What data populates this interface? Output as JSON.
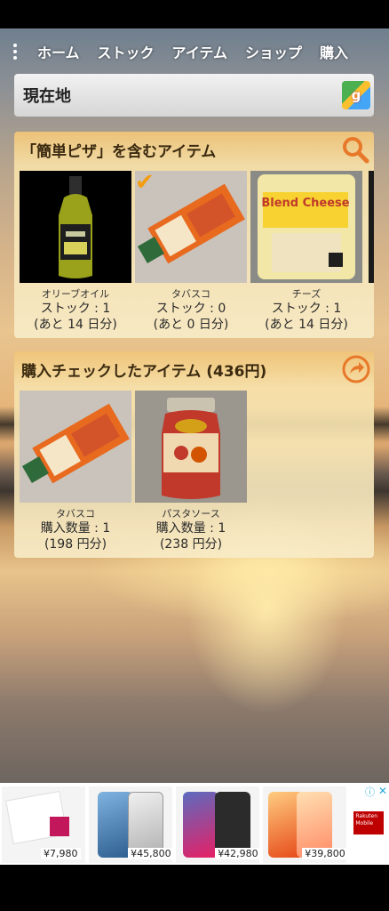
{
  "nav": {
    "tabs": [
      "ホーム",
      "ストック",
      "アイテム",
      "ショップ",
      "購入"
    ]
  },
  "location": {
    "label": "現在地"
  },
  "search_card": {
    "title": "「簡単ピザ」を含むアイテム",
    "items": [
      {
        "name": "オリーブオイル",
        "stock": "ストック : 1",
        "remain": "(あと 14 日分)",
        "checked": false
      },
      {
        "name": "タバスコ",
        "stock": "ストック : 0",
        "remain": "(あと 0 日分)",
        "checked": true
      },
      {
        "name": "チーズ",
        "stock": "ストック : 1",
        "remain": "(あと 14 日分)",
        "checked": false
      }
    ]
  },
  "purchase_card": {
    "title": "購入チェックしたアイテム (436円)",
    "items": [
      {
        "name": "タバスコ",
        "qty": "購入数量 : 1",
        "price": "(198 円分)"
      },
      {
        "name": "パスタソース",
        "qty": "購入数量 : 1",
        "price": "(238 円分)"
      }
    ]
  },
  "cheese_label": "Blend Cheese",
  "ad": {
    "prices": [
      "¥7,980",
      "¥45,800",
      "¥42,980",
      "¥39,800"
    ],
    "brand": "Rakuten Mobile"
  },
  "colors": {
    "accent": "#e8782a",
    "card": "#f5dca0"
  }
}
